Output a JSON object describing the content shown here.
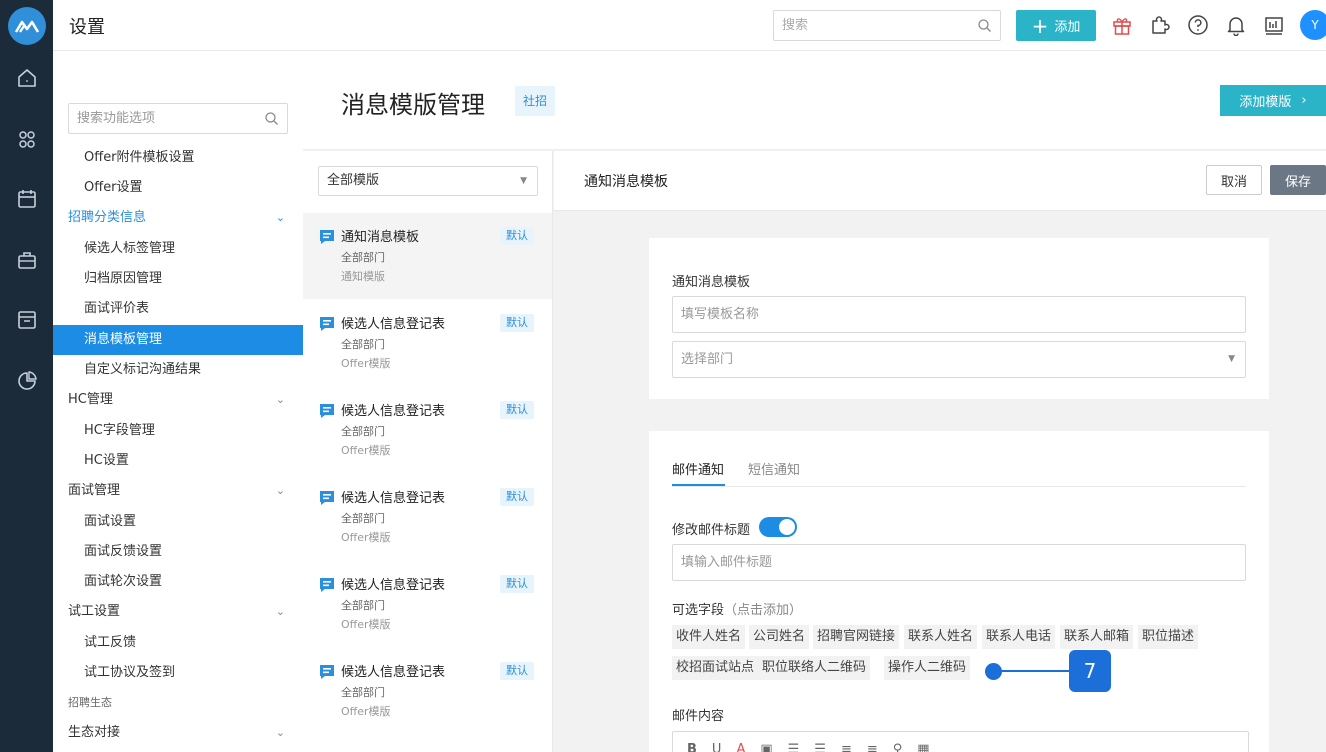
{
  "app": {
    "title": "设置"
  },
  "header": {
    "search_placeholder": "搜索",
    "add_label": "添加",
    "avatar_initial": "Y"
  },
  "rail": {
    "icons": [
      "home-icon",
      "people-icon",
      "calendar-icon",
      "briefcase-icon",
      "archive-icon",
      "chart-icon"
    ]
  },
  "menu": {
    "search_placeholder": "搜索功能选项",
    "items": [
      {
        "label": "Offer附件模板设置",
        "kind": "sub"
      },
      {
        "label": "Offer设置",
        "kind": "sub"
      },
      {
        "label": "招聘分类信息",
        "kind": "group",
        "expanded": true,
        "accent": true
      },
      {
        "label": "候选人标签管理",
        "kind": "sub"
      },
      {
        "label": "归档原因管理",
        "kind": "sub"
      },
      {
        "label": "面试评价表",
        "kind": "sub"
      },
      {
        "label": "消息模板管理",
        "kind": "sub",
        "active": true
      },
      {
        "label": "自定义标记沟通结果",
        "kind": "sub"
      },
      {
        "label": "HC管理",
        "kind": "group"
      },
      {
        "label": "HC字段管理",
        "kind": "sub"
      },
      {
        "label": "HC设置",
        "kind": "sub"
      },
      {
        "label": "面试管理",
        "kind": "group"
      },
      {
        "label": "面试设置",
        "kind": "sub"
      },
      {
        "label": "面试反馈设置",
        "kind": "sub"
      },
      {
        "label": "面试轮次设置",
        "kind": "sub"
      },
      {
        "label": "试工设置",
        "kind": "group"
      },
      {
        "label": "试工反馈",
        "kind": "sub"
      },
      {
        "label": "试工协议及签到",
        "kind": "sub"
      },
      {
        "label": "招聘生态",
        "kind": "section"
      },
      {
        "label": "生态对接",
        "kind": "group"
      }
    ]
  },
  "page": {
    "title": "消息模版管理",
    "tag": "社招",
    "add_template_label": "添加模版"
  },
  "list": {
    "filter_value": "全部模版",
    "templates": [
      {
        "title": "通知消息模板",
        "dept": "全部部门",
        "kind": "通知模版",
        "badge": "默认",
        "selected": true
      },
      {
        "title": "候选人信息登记表",
        "dept": "全部部门",
        "kind": "Offer模版",
        "badge": "默认"
      },
      {
        "title": "候选人信息登记表",
        "dept": "全部部门",
        "kind": "Offer模版",
        "badge": "默认"
      },
      {
        "title": "候选人信息登记表",
        "dept": "全部部门",
        "kind": "Offer模版",
        "badge": "默认"
      },
      {
        "title": "候选人信息登记表",
        "dept": "全部部门",
        "kind": "Offer模版",
        "badge": "默认"
      },
      {
        "title": "候选人信息登记表",
        "dept": "全部部门",
        "kind": "Offer模版",
        "badge": "默认"
      }
    ]
  },
  "editor": {
    "title": "通知消息模板",
    "cancel_label": "取消",
    "save_label": "保存",
    "basic": {
      "label": "通知消息模板",
      "name_placeholder": "填写模板名称",
      "dept_placeholder": "选择部门"
    },
    "tabs": [
      "邮件通知",
      "短信通知"
    ],
    "email": {
      "subject_toggle_label": "修改邮件标题",
      "subject_toggle_on": true,
      "subject_placeholder": "填输入邮件标题",
      "fields_label": "可选字段",
      "fields_hint": "（点击添加）",
      "fields": [
        "收件人姓名",
        "公司姓名",
        "招聘官网链接",
        "联系人姓名",
        "联系人电话",
        "联系人邮箱",
        "职位描述",
        "校招面试站点",
        "职位联络人二维码",
        "操作人二维码"
      ],
      "content_label": "邮件内容",
      "toolbar": [
        "B",
        "U",
        "A",
        "▣",
        "☰",
        "☰",
        "≡",
        "≡",
        "⚲",
        "▦"
      ]
    }
  },
  "annotation": {
    "number": "7"
  }
}
